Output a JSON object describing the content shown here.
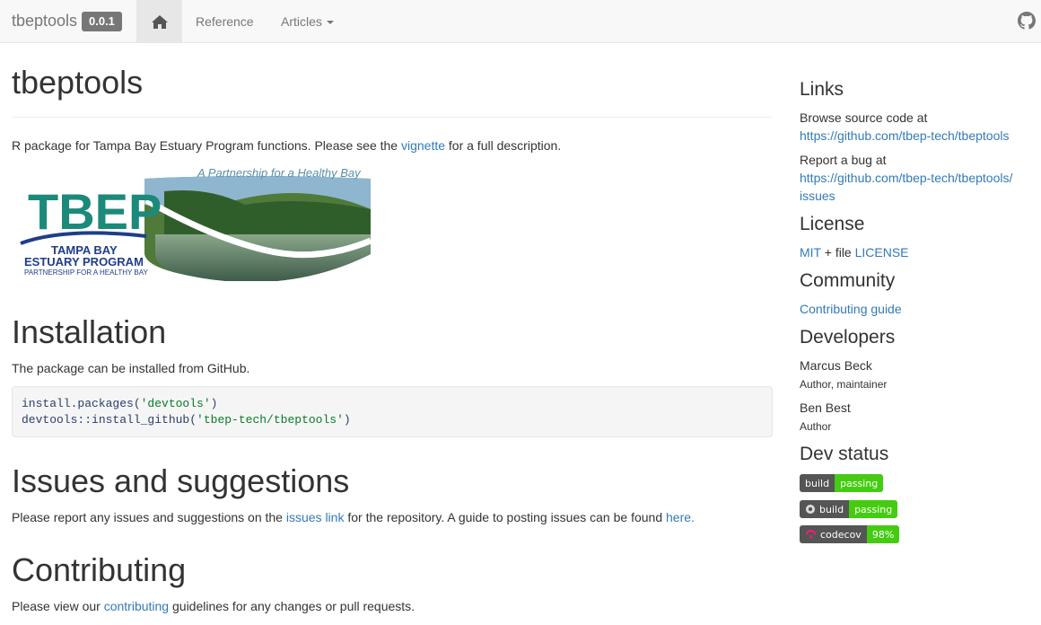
{
  "navbar": {
    "brand": "tbeptools",
    "version": "0.0.1",
    "home_icon": "home-icon",
    "reference": "Reference",
    "articles": "Articles",
    "github_icon": "github-icon"
  },
  "main": {
    "title": "tbeptools",
    "intro_prefix": "R package for Tampa Bay Estuary Program functions. Please see the ",
    "intro_link": "vignette",
    "intro_suffix": " for a full description.",
    "logo": {
      "tagline": "A Partnership for a Healthy Bay",
      "big": "TBEP",
      "line1": "TAMPA BAY",
      "line2": "ESTUARY PROGRAM",
      "line3": "PARTNERSHIP FOR A HEALTHY BAY"
    },
    "installation": {
      "heading": "Installation",
      "text": "The package can be installed from GitHub.",
      "code_line1_fn": "install.packages(",
      "code_line1_str": "'devtools'",
      "code_line1_end": ")",
      "code_line2_fn": "devtools::install_github(",
      "code_line2_str": "'tbep-tech/tbeptools'",
      "code_line2_end": ")"
    },
    "issues": {
      "heading": "Issues and suggestions",
      "text_prefix": "Please report any issues and suggestions on the ",
      "link1": "issues link",
      "text_mid": " for the repository. A guide to posting issues can be found ",
      "link2": "here."
    },
    "contributing": {
      "heading": "Contributing",
      "text_prefix": "Please view our ",
      "link": "contributing",
      "text_suffix": " guidelines for any changes or pull requests."
    }
  },
  "sidebar": {
    "links_heading": "Links",
    "browse_text": "Browse source code at",
    "browse_url": "https://github.com/tbep-tech/tbeptools",
    "bug_text": "Report a bug at",
    "bug_url_1": "https://github.com/tbep-tech/tbeptools/",
    "bug_url_2": "issues",
    "license_heading": "License",
    "license_mit": "MIT",
    "license_plus": " + file ",
    "license_file": "LICENSE",
    "community_heading": "Community",
    "contributing_guide": "Contributing guide",
    "developers_heading": "Developers",
    "dev1_name": "Marcus Beck",
    "dev1_role": "Author, maintainer",
    "dev2_name": "Ben Best",
    "dev2_role": "Author",
    "devstatus_heading": "Dev status",
    "badges": [
      {
        "left": "build",
        "right": "passing",
        "icon": ""
      },
      {
        "left": "build",
        "right": "passing",
        "icon": "appveyor-icon"
      },
      {
        "left": "codecov",
        "right": "98%",
        "icon": "codecov-icon"
      }
    ]
  },
  "colors": {
    "link": "#337ab7",
    "badge_left": "#555555",
    "badge_right": "#44cc11"
  }
}
